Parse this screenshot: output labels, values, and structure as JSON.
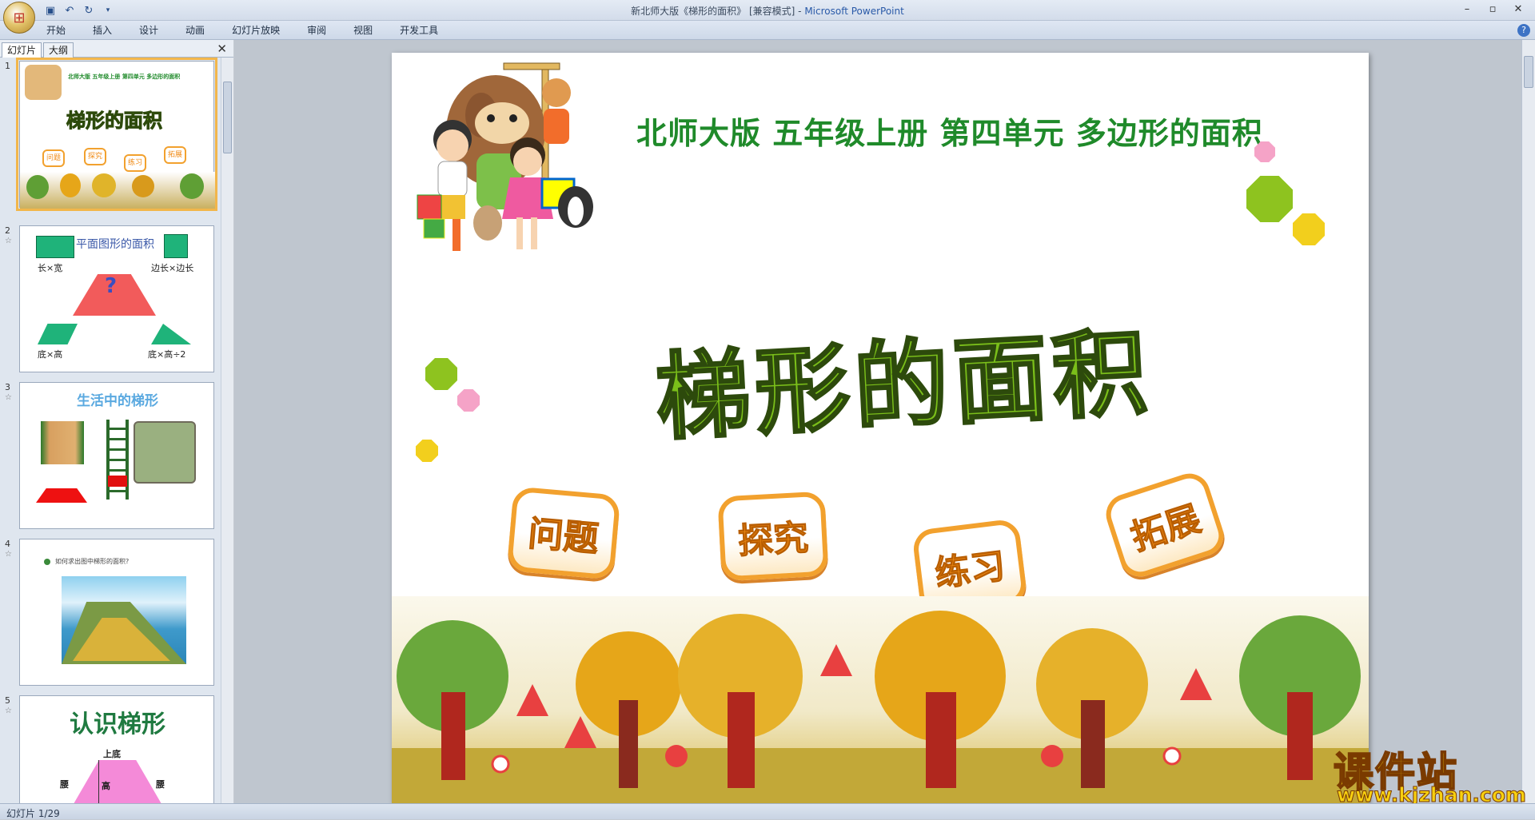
{
  "window": {
    "title": "新北师大版《梯形的面积》 [兼容模式] -",
    "app_name": "Microsoft PowerPoint"
  },
  "ribbon": {
    "tabs": [
      "开始",
      "插入",
      "设计",
      "动画",
      "幻灯片放映",
      "审阅",
      "视图",
      "开发工具"
    ]
  },
  "panel": {
    "tabs": [
      "幻灯片",
      "大纲"
    ],
    "thumbnails": [
      {
        "num": "1",
        "star": ""
      },
      {
        "num": "2",
        "star": "☆",
        "title": "平面图形的面积",
        "labels": [
          "长×宽",
          "边长×边长",
          "底×高",
          "底×高÷2",
          "?"
        ]
      },
      {
        "num": "3",
        "star": "☆",
        "title": "生活中的梯形"
      },
      {
        "num": "4",
        "star": "☆",
        "caption": "如何求出图中梯形的面积?"
      },
      {
        "num": "5",
        "star": "☆",
        "title": "认识梯形",
        "labels": [
          "上底",
          "腰",
          "高",
          "腰"
        ]
      }
    ]
  },
  "slide": {
    "subtitle": "北师大版  五年级上册  第四单元  多边形的面积",
    "title": "梯形的面积",
    "buttons": [
      "问题",
      "探究",
      "练习",
      "拓展"
    ],
    "thumb1_subtitle": "北师大版  五年级上册  第四单元  多边形的面积"
  },
  "watermark": {
    "title": "课件站",
    "url": "www.kjzhan.com"
  },
  "status": {
    "slide_indicator": "幻灯片 1/29"
  },
  "colors": {
    "title_green": "#7bbf1a",
    "subtitle_green": "#1f8a2a",
    "badge_orange": "#f2a12e"
  }
}
